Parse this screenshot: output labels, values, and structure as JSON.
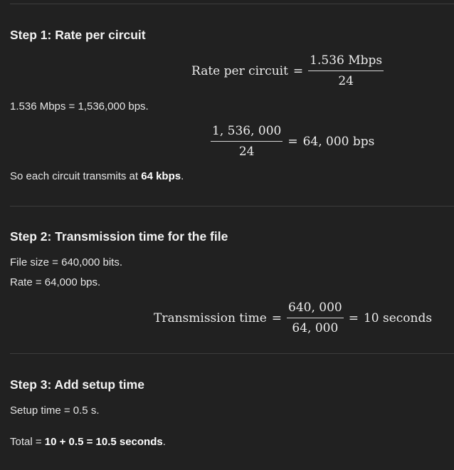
{
  "step1": {
    "heading": "Step 1: Rate per circuit",
    "eq1": {
      "lhs": "Rate per circuit",
      "rel": "=",
      "num": "1.536 Mbps",
      "den": "24"
    },
    "conversion": "1.536 Mbps = 1,536,000 bps.",
    "eq2": {
      "num": "1, 536, 000",
      "den": "24",
      "rel": "=",
      "rhs": "64, 000 bps"
    },
    "conclusion_prefix": "So each circuit transmits at ",
    "conclusion_value": "64 kbps",
    "conclusion_suffix": "."
  },
  "step2": {
    "heading": "Step 2: Transmission time for the file",
    "file_size": "File size = 640,000 bits.",
    "rate": "Rate = 64,000 bps.",
    "eq": {
      "lhs": "Transmission time",
      "rel1": "=",
      "num": "640, 000",
      "den": "64, 000",
      "rel2": "=",
      "rhs": "10 seconds"
    }
  },
  "step3": {
    "heading": "Step 3: Add setup time",
    "setup": "Setup time = 0.5 s.",
    "total_prefix": "Total = ",
    "total_value": "10 + 0.5 = 10.5 seconds",
    "total_suffix": "."
  }
}
